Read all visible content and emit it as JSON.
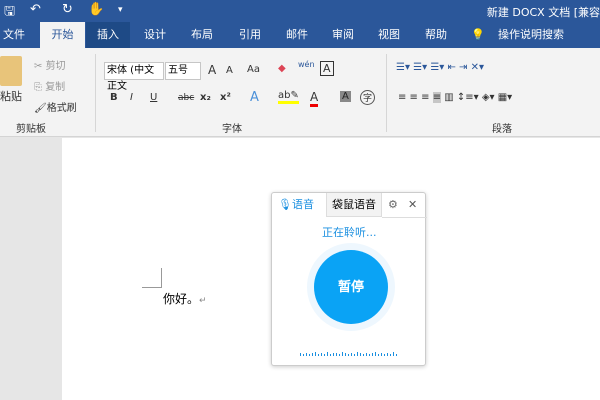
{
  "window": {
    "title": "新建 DOCX 文档 [兼容"
  },
  "quick_access": {
    "save": "🖫",
    "undo": "↶",
    "redo": "↻",
    "touch": "✋",
    "more": "▾"
  },
  "tabs": [
    {
      "label": "文件"
    },
    {
      "label": "开始"
    },
    {
      "label": "插入"
    },
    {
      "label": "设计"
    },
    {
      "label": "布局"
    },
    {
      "label": "引用"
    },
    {
      "label": "邮件"
    },
    {
      "label": "审阅"
    },
    {
      "label": "视图"
    },
    {
      "label": "帮助"
    }
  ],
  "tell_me": "操作说明搜索",
  "clipboard": {
    "paste": "粘贴",
    "cut": "剪切",
    "copy": "复制",
    "format_painter": "格式刷",
    "group": "剪贴板"
  },
  "font": {
    "name": "宋体 (中文正文",
    "size": "五号",
    "group": "字体",
    "bold": "B",
    "italic": "I",
    "underline": "U",
    "strike": "abc",
    "sub": "x₂",
    "sup": "x²",
    "grow": "A",
    "shrink": "A",
    "case": "Aa",
    "phonetic": "wén",
    "border": "A",
    "shade": "A",
    "enclose": "字"
  },
  "paragraph": {
    "group": "段落"
  },
  "document": {
    "text": "你好。",
    "para_mark": "↵"
  },
  "voice": {
    "tab_voice": "语音",
    "tab_mouse": "袋鼠语音",
    "status": "正在聆听...",
    "pause": "暂停"
  },
  "colors": {
    "brand": "#2b579a",
    "accent": "#0aa3f5"
  }
}
